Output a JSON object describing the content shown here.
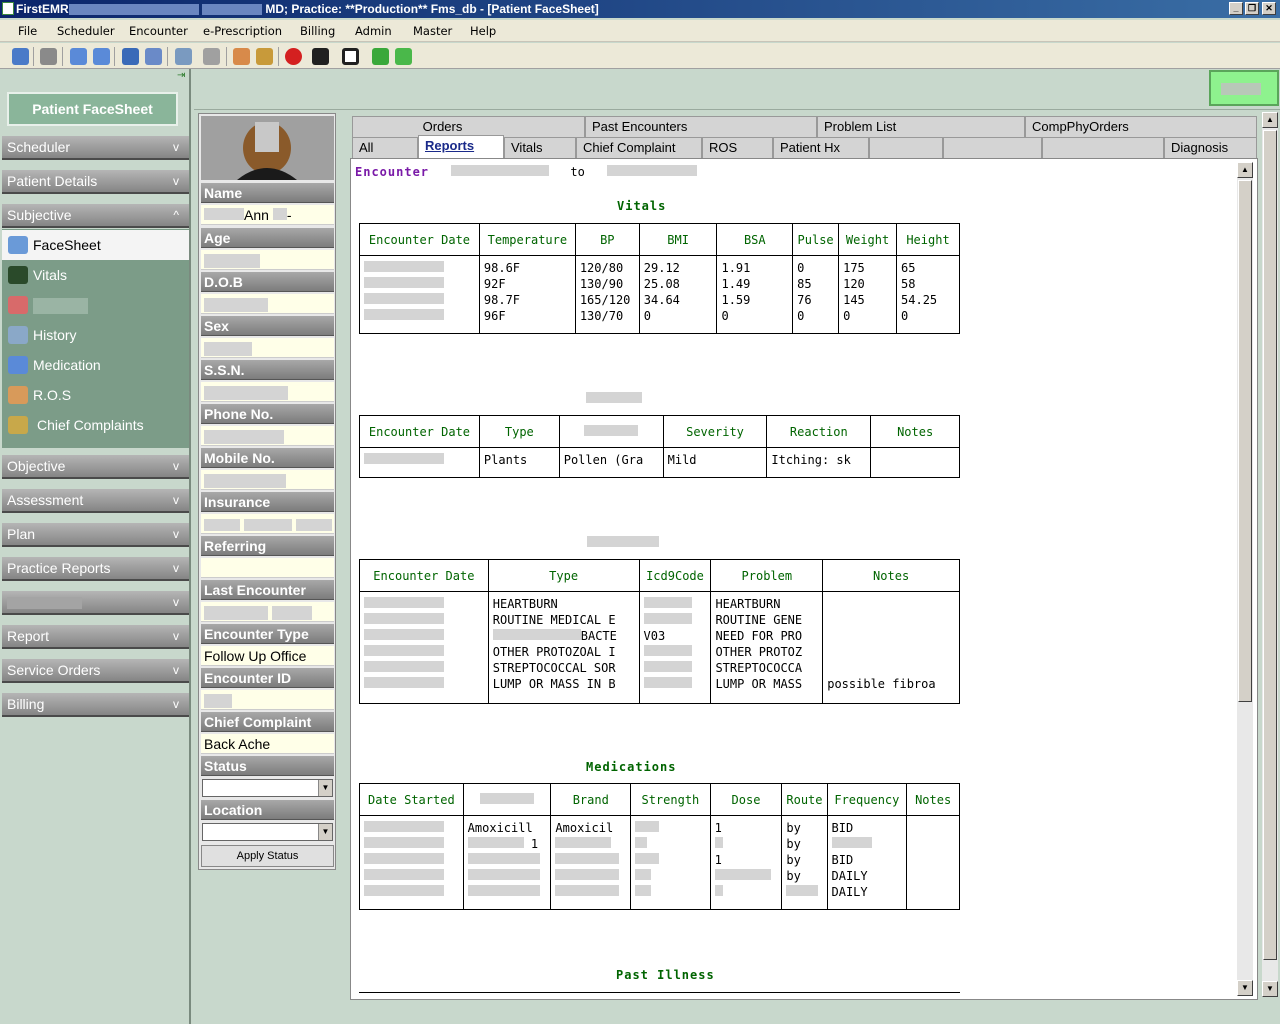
{
  "window": {
    "title_prefix": "FirstEMR",
    "title_suffix": " MD; Practice: **Production** Fms_db - [Patient FaceSheet]"
  },
  "menu": [
    "File",
    "Scheduler",
    "Encounter",
    "e-Prescription",
    "Billing",
    "Admin",
    "Master",
    "Help"
  ],
  "nav": {
    "facesheet_button": "Patient FaceSheet",
    "sections_top": [
      {
        "label": "Scheduler",
        "chev": "v"
      },
      {
        "label": "Patient Details",
        "chev": "v"
      },
      {
        "label": "Subjective",
        "chev": "^"
      }
    ],
    "subjective_items": [
      "FaceSheet",
      "Vitals",
      "",
      "History",
      "Medication",
      "R.O.S",
      "Chief Complaints"
    ],
    "sections_bottom": [
      {
        "label": "Objective",
        "chev": "v"
      },
      {
        "label": "Assessment",
        "chev": "v"
      },
      {
        "label": "Plan",
        "chev": "v"
      },
      {
        "label": "Practice Reports",
        "chev": "v"
      },
      {
        "label": "",
        "chev": "v"
      },
      {
        "label": "Report",
        "chev": "v"
      },
      {
        "label": "Service Orders",
        "chev": "v"
      },
      {
        "label": "Billing",
        "chev": "v"
      }
    ]
  },
  "patient": {
    "labels": {
      "name": "Name",
      "age": "Age",
      "dob": "D.O.B",
      "sex": "Sex",
      "ssn": "S.S.N.",
      "phone": "Phone No.",
      "mobile": "Mobile No.",
      "insurance": "Insurance",
      "referring": "Referring",
      "last_encounter": "Last Encounter",
      "encounter_type": "Encounter Type",
      "encounter_id": "Encounter ID",
      "chief_complaint": "Chief Complaint",
      "status": "Status",
      "location": "Location"
    },
    "name_visible": "Ann",
    "name_tail": "-",
    "encounter_type": "Follow Up Office",
    "chief_complaint": "Back Ache",
    "apply_status": "Apply Status"
  },
  "tabs": {
    "row1": [
      "Orders",
      "Past Encounters",
      "Problem List",
      "CompPhyOrders"
    ],
    "row2": [
      "All",
      "Reports",
      "Vitals",
      "Chief Complaint",
      "ROS",
      "Patient Hx",
      "",
      "",
      "",
      "Diagnosis"
    ],
    "active": "Reports"
  },
  "report": {
    "encounter_label": "Encounter",
    "to_label": "to",
    "vitals": {
      "title": "Vitals",
      "headers": [
        "Encounter Date",
        "Temperature",
        "BP",
        "BMI",
        "BSA",
        "Pulse",
        "Weight",
        "Height"
      ],
      "rows": [
        [
          "",
          "98.6F",
          "120/80",
          "29.12",
          "1.91",
          "0",
          "175",
          "65"
        ],
        [
          "",
          "92F",
          "130/90",
          "25.08",
          "1.49",
          "85",
          "120",
          "58"
        ],
        [
          "",
          "98.7F",
          "165/120",
          "34.64",
          "1.59",
          "76",
          "145",
          "54.25"
        ],
        [
          "",
          "96F",
          "130/70",
          "0",
          "0",
          "0",
          "0",
          "0"
        ]
      ]
    },
    "allergies": {
      "headers": [
        "Encounter Date",
        "Type",
        "",
        "Severity",
        "Reaction",
        "Notes"
      ],
      "rows": [
        [
          "",
          "Plants",
          "Pollen (Gra",
          "Mild",
          "Itching: sk",
          ""
        ]
      ]
    },
    "problems": {
      "headers": [
        "Encounter Date",
        "Type",
        "Icd9Code",
        "Problem",
        "Notes"
      ],
      "rows": [
        [
          "",
          "HEARTBURN",
          "",
          "HEARTBURN",
          ""
        ],
        [
          "",
          "ROUTINE MEDICAL E",
          "",
          "ROUTINE GENE",
          ""
        ],
        [
          "",
          "BACTE",
          "V03",
          "NEED FOR PRO",
          ""
        ],
        [
          "",
          "OTHER PROTOZOAL I",
          "",
          "OTHER PROTOZ",
          ""
        ],
        [
          "",
          "STREPTOCOCCAL SOR",
          "",
          "STREPTOCOCCA",
          ""
        ],
        [
          "",
          "LUMP OR MASS IN B",
          "",
          "LUMP OR MASS",
          "possible fibroa"
        ]
      ]
    },
    "medications": {
      "title": "Medications",
      "headers": [
        "Date Started",
        "",
        "Brand",
        "Strength",
        "Dose",
        "Route",
        "Frequency",
        "Notes"
      ],
      "rows": [
        [
          "",
          "Amoxicill",
          "Amoxicil",
          "",
          "1",
          "by",
          "BID",
          ""
        ],
        [
          "",
          "1",
          "",
          "",
          "",
          "by",
          "",
          ""
        ],
        [
          "",
          "",
          "",
          "",
          "1",
          "by",
          "BID",
          ""
        ],
        [
          "",
          "",
          "",
          "",
          "",
          "by",
          "DAILY",
          ""
        ],
        [
          "",
          "",
          "",
          "",
          "",
          "",
          "DAILY",
          ""
        ]
      ]
    },
    "past_illness": {
      "title": "Past Illness"
    }
  }
}
